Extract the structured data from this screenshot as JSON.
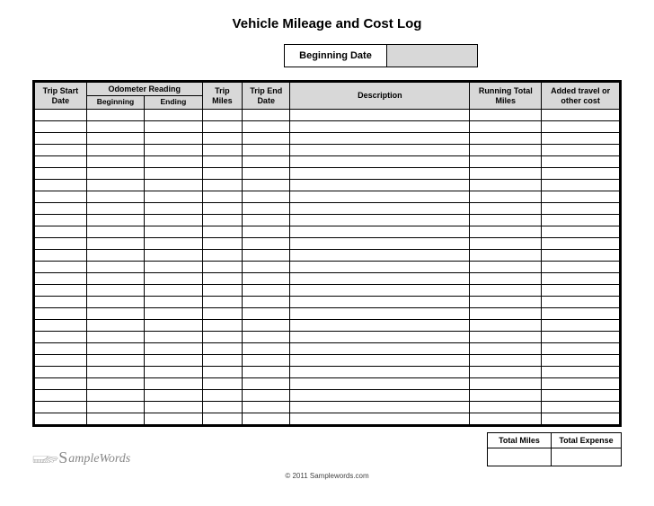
{
  "title": "Vehicle Mileage and Cost Log",
  "beginning_date": {
    "label": "Beginning Date",
    "value": ""
  },
  "columns": {
    "trip_start_date": "Trip Start Date",
    "odometer_reading": "Odometer Reading",
    "odometer_beginning": "Beginning",
    "odometer_ending": "Ending",
    "trip_miles": "Trip Miles",
    "trip_end_date": "Trip End Date",
    "description": "Description",
    "running_total_miles": "Running Total Miles",
    "added_cost": "Added travel or other cost"
  },
  "row_count": 27,
  "logo_text": "ampleWords",
  "totals": {
    "miles_label": "Total Miles",
    "miles_value": "",
    "expense_label": "Total Expense",
    "expense_value": ""
  },
  "copyright": "© 2011 Samplewords.com"
}
